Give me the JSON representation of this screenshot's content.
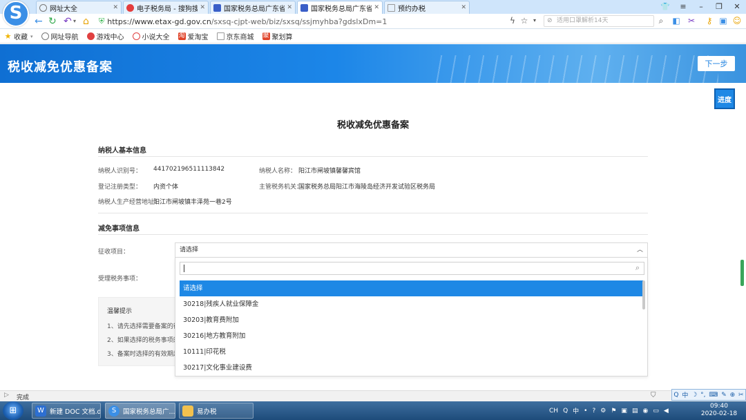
{
  "browser": {
    "tabs": [
      {
        "label": "网址大全"
      },
      {
        "label": "电子税务局 - 搜狗搜索"
      },
      {
        "label": "国家税务总局广东省电子"
      },
      {
        "label": "国家税务总局广东省电子"
      },
      {
        "label": "预约办税"
      }
    ],
    "active_tab_index": 3,
    "url_host": "https://www.etax-gd.gov.cn",
    "url_path": "/sxsq-cjpt-web/biz/sxsq/ssjmyhba?gdslxDm=1",
    "search_placeholder": "适用口罩解析14天",
    "bookmarks": [
      {
        "label": "收藏",
        "icon": "star-icon"
      },
      {
        "label": "网址导航",
        "icon": "globe-icon"
      },
      {
        "label": "游戏中心",
        "icon": "game-icon"
      },
      {
        "label": "小说大全",
        "icon": "book-icon"
      },
      {
        "label": "爱淘宝",
        "icon": "taobao-icon"
      },
      {
        "label": "京东商城",
        "icon": "page-icon"
      },
      {
        "label": "聚划算",
        "icon": "juhuasuan-icon"
      }
    ]
  },
  "header": {
    "title": "税收减免优惠备案",
    "next_label": "下一步",
    "progress_label": "进度"
  },
  "form": {
    "title": "税收减免优惠备案",
    "basic_section": "纳税人基本信息",
    "basic_fields": {
      "taxpayer_id_label": "纳税人识别号：",
      "taxpayer_id_value": "441702196511113842",
      "taxpayer_name_label": "纳税人名称：",
      "taxpayer_name_value": "阳江市闸坡镇馨馨宾馆",
      "reg_type_label": "登记注册类型：",
      "reg_type_value": "内资个体",
      "tax_office_label": "主管税务机关：",
      "tax_office_value": "国家税务总局阳江市海陵岛经济开发试验区税务局",
      "address_label": "纳税人生产经营地址：",
      "address_value": "阳江市闸坡镇丰泽苑一巷2号"
    },
    "exemption_section": "减免事项信息",
    "levy_label": "征收项目：",
    "levy_select_value": "请选择",
    "matter_label": "受理税务事项：",
    "dropdown_options": [
      "请选择",
      "30218|残疾人就业保障金",
      "30203|教育费附加",
      "30216|地方教育附加",
      "10111|印花税",
      "30217|文化事业建设费"
    ],
    "selected_option_index": 0,
    "tips_title": "温馨提示",
    "tips": [
      "1、请先选择需要备案的征",
      "2、如果选择的税务事项的",
      "3、备案时选择的有效期起"
    ]
  },
  "status": {
    "text": "完成"
  },
  "ime": {
    "items": [
      "Q",
      "中",
      "☽",
      "°,",
      "⌨",
      "✎",
      "⊕",
      "✂"
    ]
  },
  "taskbar": {
    "items": [
      {
        "label": "新建 DOC 文档.d...",
        "icon": "wps-icon"
      },
      {
        "label": "国家税务总局广...",
        "icon": "sogou-browser-icon"
      },
      {
        "label": "易办税",
        "icon": "folder-icon"
      }
    ],
    "active_index": 1,
    "tray_lang": "CH",
    "time": "09:40",
    "date": "2020-02-18"
  },
  "colors": {
    "header_blue": "#1c86e8",
    "selected_option": "#1e88e5",
    "progress_button": "#1e88e5"
  }
}
